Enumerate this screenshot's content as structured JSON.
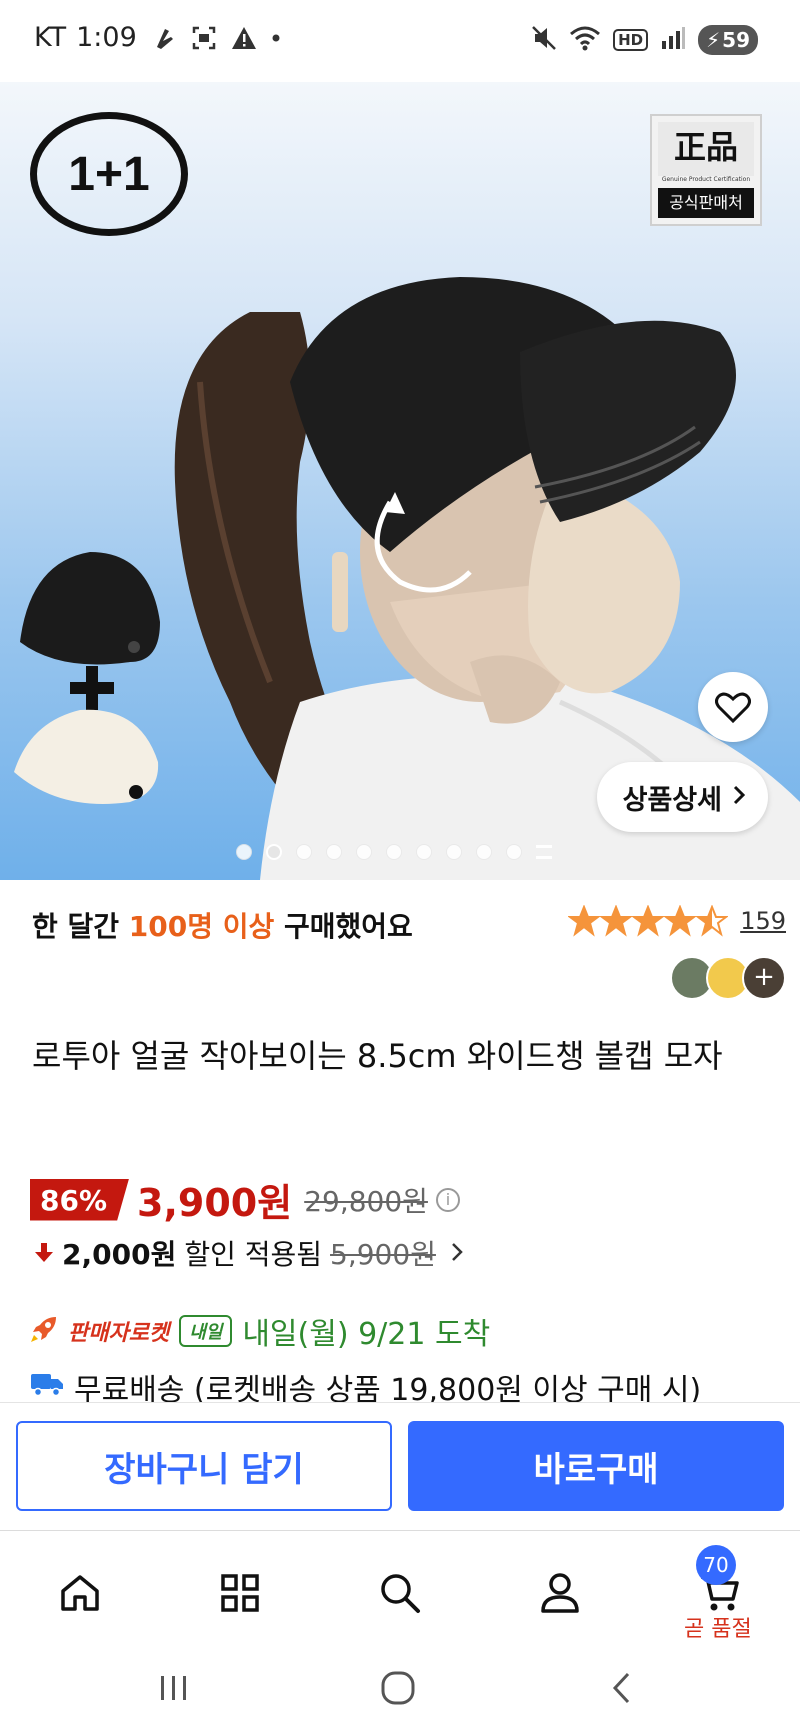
{
  "status_bar": {
    "carrier": "KT",
    "time": "1:09",
    "battery": "59",
    "network_badge": "HD",
    "icons": [
      "steps-icon",
      "screenshot-icon",
      "warning-icon",
      "dot-icon",
      "mute-icon",
      "wifi-icon",
      "hd-icon",
      "signal-icon",
      "battery-icon"
    ]
  },
  "hero": {
    "promo_badge": "1+1",
    "cert_badge": {
      "title": "正品",
      "subtitle": "Genuine Product Certification",
      "label": "공식판매처"
    },
    "detail_button": "상품상세",
    "carousel_count": 11,
    "carousel_active_index": 1
  },
  "summary": {
    "purchase_prefix": "한 달간",
    "purchase_highlight": "100명 이상",
    "purchase_suffix": "구매했어요",
    "rating": 4.5,
    "review_count": "159"
  },
  "product": {
    "title": "로투아 얼굴 작아보이는 8.5cm 와이드챙 볼캡 모자"
  },
  "price": {
    "discount": "86%",
    "sale_price": "3,900원",
    "original_price": "29,800원"
  },
  "coupon": {
    "amount": "2,000원",
    "text": "할인 적용됨",
    "original": "5,900원"
  },
  "delivery": {
    "seller_rocket": "판매자로켓",
    "tomorrow_tag": "내일",
    "arrival": "내일(월) 9/21 도착",
    "shipping": "무료배송 (로켓배송 상품 19,800원 이상 구매 시)"
  },
  "actions": {
    "add_to_cart": "장바구니 담기",
    "buy_now": "바로구매"
  },
  "bottom_nav": {
    "items": [
      "home-icon",
      "category-icon",
      "search-icon",
      "my-page-icon",
      "cart-icon"
    ],
    "cart_badge": "70",
    "soldout_label": "곧 품절"
  },
  "colors": {
    "accent_blue": "#346aff",
    "price_red": "#c4180f",
    "highlight_orange": "#e8601a",
    "delivery_green": "#2f8a2f",
    "star_orange": "#f5943b"
  }
}
